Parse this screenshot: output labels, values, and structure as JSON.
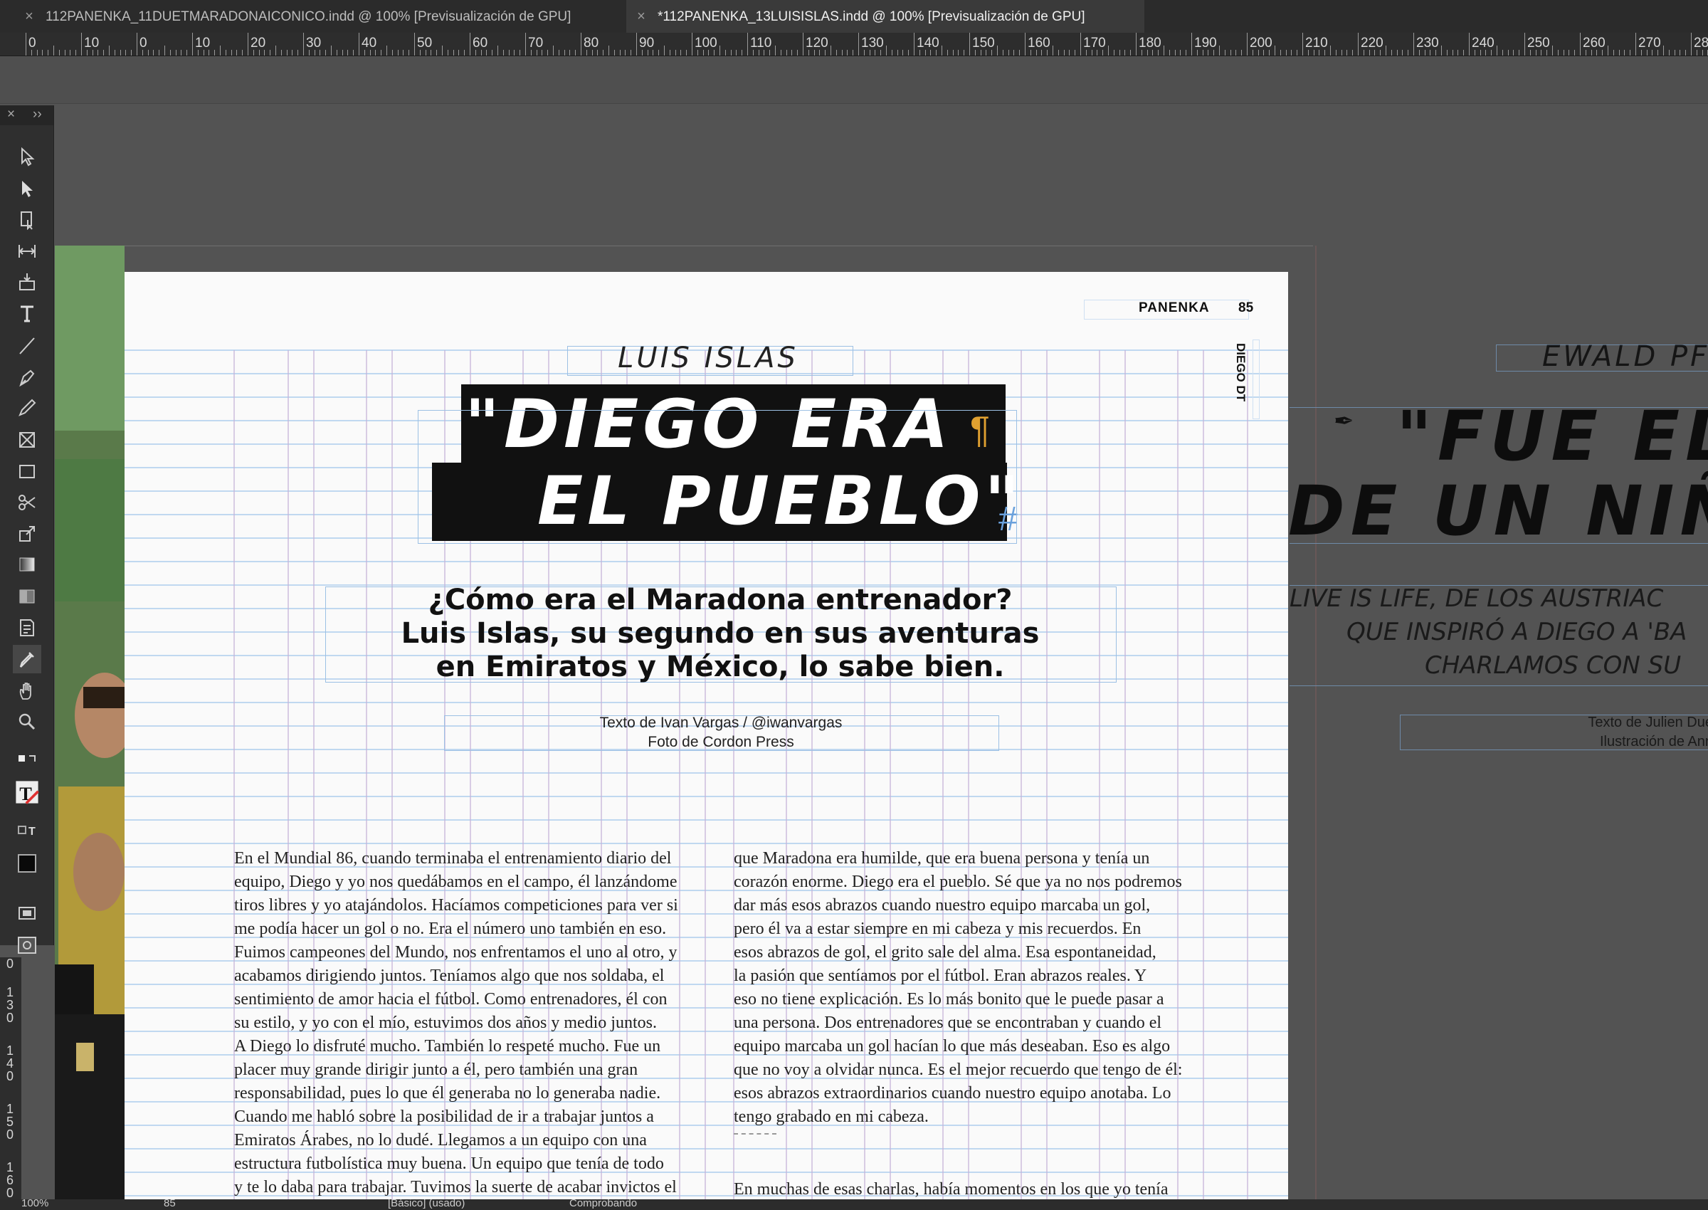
{
  "tabs": [
    {
      "label": "112PANENKA_11DUETMARADONAICONICO.indd @ 100% [Previsualización de GPU]"
    },
    {
      "label": "*112PANENKA_13LUISISLAS.indd @ 100% [Previsualización de GPU]"
    }
  ],
  "ruler": {
    "h_labels": [
      "0",
      "10",
      "0",
      "10",
      "20",
      "30",
      "40",
      "50",
      "60",
      "70",
      "80",
      "90",
      "100",
      "110",
      "120",
      "130",
      "140",
      "150",
      "160",
      "170",
      "180",
      "190",
      "200",
      "210",
      "220",
      "230",
      "240",
      "250",
      "260",
      "270",
      "280"
    ],
    "v_labels": [
      "0",
      "130",
      "140",
      "150",
      "160"
    ]
  },
  "toolbar": {
    "icons": [
      "selection-tool-icon",
      "direct-selection-tool-icon",
      "page-tool-icon",
      "gap-tool-icon",
      "content-collector-icon",
      "type-tool-icon",
      "line-tool-icon",
      "pen-tool-icon",
      "pencil-tool-icon",
      "rectangle-frame-tool-icon",
      "rectangle-tool-icon",
      "scissors-tool-icon",
      "free-transform-tool-icon",
      "gradient-swatch-tool-icon",
      "gradient-feather-tool-icon",
      "note-tool-icon",
      "eyedropper-tool-icon",
      "hand-tool-icon",
      "zoom-tool-icon"
    ]
  },
  "page": {
    "header_brand": "PANENKA",
    "page_number": "85",
    "vertical_tag": "DIEGO DT",
    "kicker": "LUIS ISLAS",
    "headline_line1": "\"DIEGO ERA",
    "headline_line2": "EL PUEBLO\"",
    "deck_line1": "¿Cómo era el Maradona entrenador?",
    "deck_line2": "Luis Islas, su segundo en sus aventuras",
    "deck_line3": "en Emiratos y México, lo sabe bien.",
    "credit_line1": "Texto de Ivan Vargas / @iwanvargas",
    "credit_line2": "Foto de Cordon Press",
    "col1_lines": [
      "En el Mundial 86, cuando terminaba el entrenamiento diario del",
      "equipo, Diego y yo nos quedábamos en el campo, él lanzándome",
      "tiros libres y yo atajándolos. Hacíamos competiciones para ver si",
      "me podía hacer un gol o no. Era el número uno también en eso.",
      "Fuimos campeones del Mundo, nos enfrentamos el uno al otro, y",
      "acabamos dirigiendo juntos. Teníamos algo que nos soldaba, el",
      "sentimiento de amor hacia el fútbol. Como entrenadores, él con",
      "su estilo, y yo con el mío, estuvimos dos años y medio juntos.",
      "A Diego lo disfruté mucho. También lo respeté mucho. Fue un",
      "placer muy grande dirigir junto a él, pero también una gran",
      "responsabilidad, pues lo que él generaba no lo generaba nadie.",
      "Cuando me habló sobre la posibilidad de ir a trabajar juntos a",
      "Emiratos Árabes, no lo dudé. Llegamos a un equipo con una",
      "estructura futbolística muy buena. Un equipo que tenía de todo",
      "y te lo daba para trabajar. Tuvimos la suerte de acabar invictos el"
    ],
    "col2_lines": [
      "que Maradona era humilde, que era buena persona y tenía un",
      "corazón enorme. Diego era el pueblo. Sé que ya no nos podremos",
      "dar más esos abrazos cuando nuestro equipo marcaba un gol,",
      "pero él va a estar siempre en mi cabeza y mis recuerdos. En",
      "esos abrazos de gol, el grito sale del alma. Esa espontaneidad,",
      "la pasión que sentíamos por el fútbol. Eran abrazos reales. Y",
      "eso no tiene explicación. Es lo más bonito que le puede pasar a",
      "una persona. Dos entrenadores que se encontraban y cuando el",
      "equipo marcaba un gol hacían lo que más deseaban. Eso es algo",
      "que no voy a olvidar nunca. Es el mejor recuerdo que tengo de él:",
      "esos abrazos extraordinarios cuando nuestro equipo anotaba. Lo",
      "tengo grabado en mi cabeza."
    ],
    "col2_last": "En muchas de esas charlas, había momentos en los que yo tenía"
  },
  "next_page": {
    "kicker": "EWALD PFL",
    "headline_line1": "\"FUE EL",
    "headline_line2": "DE UN NIÑ",
    "deck_line1": "LIVE IS LIFE, DE LOS AUSTRIAC",
    "deck_line2": "QUE INSPIRÓ A DIEGO A 'BA",
    "deck_line3": "CHARLAMOS CON SU",
    "credit_line1": "Texto de Julien Due",
    "credit_line2": "Ilustración de Ann"
  },
  "status": {
    "zoom": "100%",
    "page": "85",
    "style": "[Básico] (usado)",
    "preflight": "Comprobando"
  },
  "colors": {
    "app_bg": "#535353",
    "panel_bg": "#2f2f2f",
    "headline_bg": "#111111",
    "grid_line": "#9ec3ea",
    "column_line": "#c7b3d9",
    "pilcrow": "#e0a030"
  }
}
